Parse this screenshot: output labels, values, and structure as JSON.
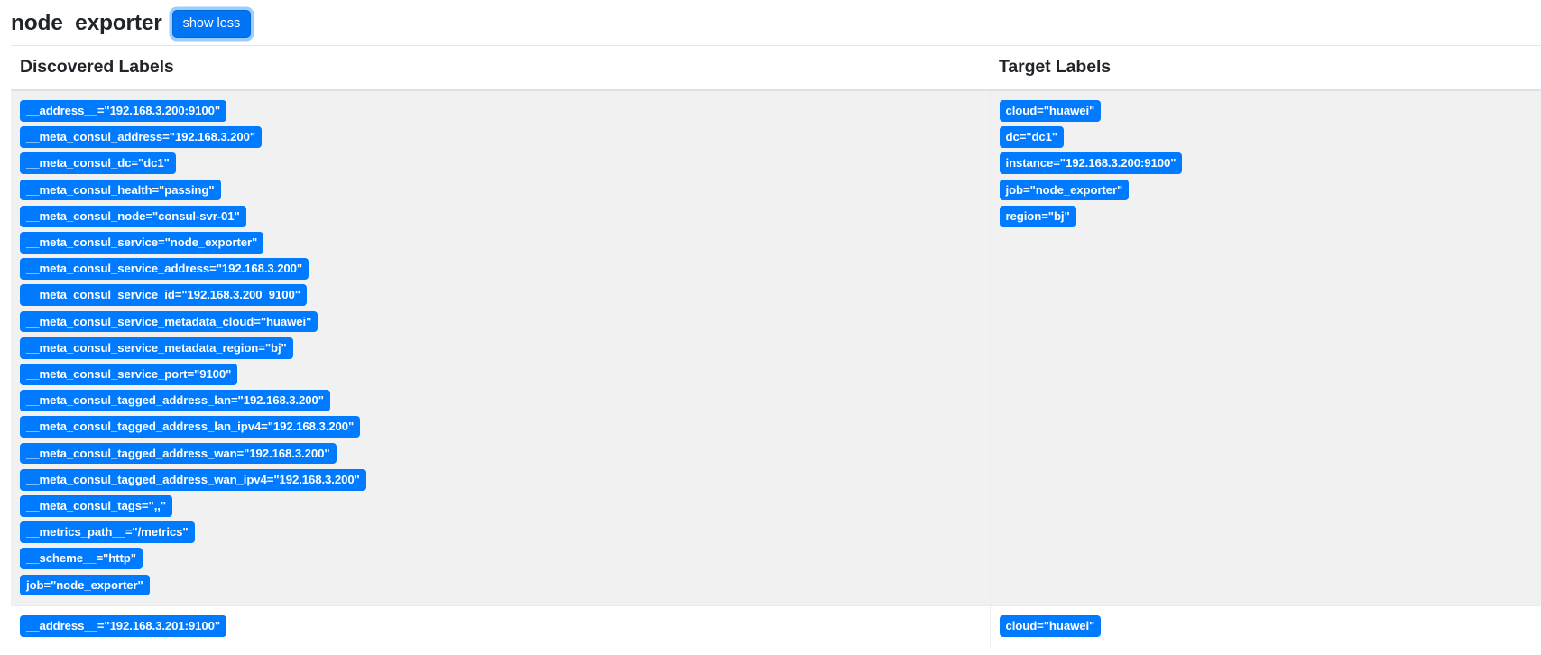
{
  "header": {
    "job_title": "node_exporter",
    "show_less_label": "show less"
  },
  "table": {
    "columns": {
      "discovered": "Discovered Labels",
      "target": "Target Labels"
    },
    "rows": [
      {
        "discovered_labels": [
          "__address__=\"192.168.3.200:9100\"",
          "__meta_consul_address=\"192.168.3.200\"",
          "__meta_consul_dc=\"dc1\"",
          "__meta_consul_health=\"passing\"",
          "__meta_consul_node=\"consul-svr-01\"",
          "__meta_consul_service=\"node_exporter\"",
          "__meta_consul_service_address=\"192.168.3.200\"",
          "__meta_consul_service_id=\"192.168.3.200_9100\"",
          "__meta_consul_service_metadata_cloud=\"huawei\"",
          "__meta_consul_service_metadata_region=\"bj\"",
          "__meta_consul_service_port=\"9100\"",
          "__meta_consul_tagged_address_lan=\"192.168.3.200\"",
          "__meta_consul_tagged_address_lan_ipv4=\"192.168.3.200\"",
          "__meta_consul_tagged_address_wan=\"192.168.3.200\"",
          "__meta_consul_tagged_address_wan_ipv4=\"192.168.3.200\"",
          "__meta_consul_tags=\",,\"",
          "__metrics_path__=\"/metrics\"",
          "__scheme__=\"http\"",
          "job=\"node_exporter\""
        ],
        "target_labels": [
          "cloud=\"huawei\"",
          "dc=\"dc1\"",
          "instance=\"192.168.3.200:9100\"",
          "job=\"node_exporter\"",
          "region=\"bj\""
        ]
      },
      {
        "discovered_labels": [
          "__address__=\"192.168.3.201:9100\""
        ],
        "target_labels": [
          "cloud=\"huawei\""
        ]
      }
    ]
  },
  "colors": {
    "badge_blue": "#007bff",
    "button_blue": "#0275f7",
    "row_stripe": "#f1f1f2",
    "border": "#dee2e6"
  }
}
